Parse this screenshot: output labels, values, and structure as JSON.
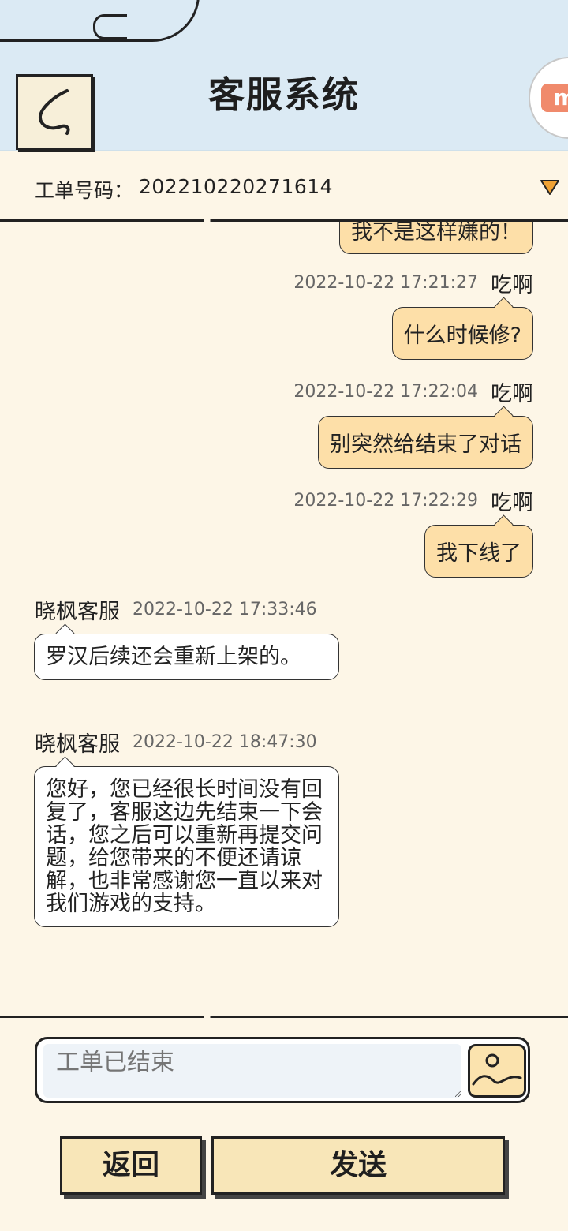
{
  "header": {
    "title": "客服系统",
    "avatar_text": "m"
  },
  "ticket": {
    "label": "工单号码：",
    "number": "202210220271614"
  },
  "messages": {
    "partial_top": "我不是这样嫌的！",
    "m1": {
      "sender": "吃啊",
      "time": "2022-10-22 17:21:27",
      "text": "什么时候修?"
    },
    "m2": {
      "sender": "吃啊",
      "time": "2022-10-22 17:22:04",
      "text": "别突然给结束了对话"
    },
    "m3": {
      "sender": "吃啊",
      "time": "2022-10-22 17:22:29",
      "text": "我下线了"
    },
    "m4": {
      "sender": "晓枫客服",
      "time": "2022-10-22 17:33:46",
      "text": "罗汉后续还会重新上架的。"
    },
    "m5": {
      "sender": "晓枫客服",
      "time": "2022-10-22 18:47:30",
      "text": "您好，您已经很长时间没有回复了，客服这边先结束一下会话，您之后可以重新再提交问题，给您带来的不便还请谅解，也非常感谢您一直以来对我们游戏的支持。"
    }
  },
  "composer": {
    "placeholder": "工单已结束"
  },
  "buttons": {
    "back": "返回",
    "send": "发送"
  },
  "colors": {
    "header_bg": "#dbeaf4",
    "page_bg": "#fdf6e7",
    "user_bubble": "#fddfa8",
    "button_bg": "#f8e6b8"
  }
}
